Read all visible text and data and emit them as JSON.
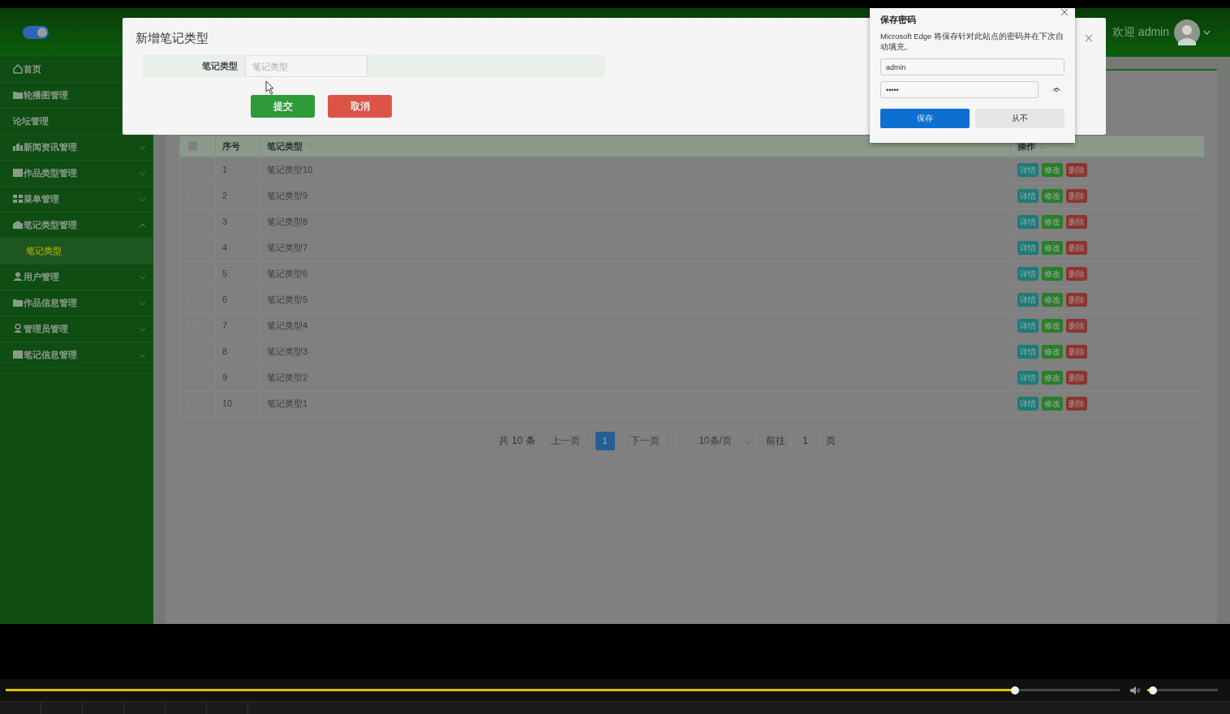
{
  "header": {
    "toggle_on": true,
    "welcome": "欢迎 admin"
  },
  "sidebar": {
    "items": [
      {
        "label": "首页",
        "kind": "link"
      },
      {
        "label": "轮播图管理",
        "kind": "link"
      },
      {
        "label": "论坛管理",
        "kind": "link"
      },
      {
        "label": "新闻资讯管理",
        "kind": "group",
        "expanded": false
      },
      {
        "label": "作品类型管理",
        "kind": "group",
        "expanded": false
      },
      {
        "label": "菜单管理",
        "kind": "group",
        "expanded": false
      },
      {
        "label": "笔记类型管理",
        "kind": "group",
        "expanded": true,
        "children": [
          {
            "label": "笔记类型",
            "selected": true
          }
        ]
      },
      {
        "label": "用户管理",
        "kind": "group",
        "expanded": false
      },
      {
        "label": "作品信息管理",
        "kind": "group",
        "expanded": false
      },
      {
        "label": "管理员管理",
        "kind": "group",
        "expanded": false
      },
      {
        "label": "笔记信息管理",
        "kind": "group",
        "expanded": false
      }
    ]
  },
  "table": {
    "select_all_checked": false,
    "columns": [
      "序号",
      "笔记类型",
      "操作"
    ],
    "rows": [
      {
        "checked": false,
        "cells": [
          "1",
          "笔记类型10"
        ],
        "actions": [
          "详情",
          "修改",
          "删除"
        ]
      },
      {
        "checked": false,
        "cells": [
          "2",
          "笔记类型9"
        ],
        "actions": [
          "详情",
          "修改",
          "删除"
        ]
      },
      {
        "checked": false,
        "cells": [
          "3",
          "笔记类型8"
        ],
        "actions": [
          "详情",
          "修改",
          "删除"
        ]
      },
      {
        "checked": false,
        "cells": [
          "4",
          "笔记类型7"
        ],
        "actions": [
          "详情",
          "修改",
          "删除"
        ]
      },
      {
        "checked": false,
        "cells": [
          "5",
          "笔记类型6"
        ],
        "actions": [
          "详情",
          "修改",
          "删除"
        ]
      },
      {
        "checked": false,
        "cells": [
          "6",
          "笔记类型5"
        ],
        "actions": [
          "详情",
          "修改",
          "删除"
        ]
      },
      {
        "checked": false,
        "cells": [
          "7",
          "笔记类型4"
        ],
        "actions": [
          "详情",
          "修改",
          "删除"
        ]
      },
      {
        "checked": false,
        "cells": [
          "8",
          "笔记类型3"
        ],
        "actions": [
          "详情",
          "修改",
          "删除"
        ]
      },
      {
        "checked": false,
        "cells": [
          "9",
          "笔记类型2"
        ],
        "actions": [
          "详情",
          "修改",
          "删除"
        ]
      },
      {
        "checked": false,
        "cells": [
          "10",
          "笔记类型1"
        ],
        "actions": [
          "详情",
          "修改",
          "删除"
        ]
      }
    ]
  },
  "pagination": {
    "total": "共 10 条",
    "prev": "上一页",
    "pages": [
      {
        "label": "1",
        "selected": true
      }
    ],
    "next": "下一页",
    "page_size": "10条/页",
    "goto": "前往",
    "goto_value": "1",
    "page_unit": "页"
  },
  "modal": {
    "title": "新增笔记类型",
    "field_label": "笔记类型",
    "field_placeholder": "笔记类型",
    "buttons": [
      "提交",
      "取消"
    ]
  },
  "password_popup": {
    "title": "保存密码",
    "message": "Microsoft Edge 将保存针对此站点的密码并在下次自动填充。",
    "username": "admin",
    "password": "•••••",
    "buttons": [
      "保存",
      "从不"
    ]
  },
  "player": {
    "progress": {
      "level": 0.906
    },
    "volume": {
      "level": 0.08
    }
  }
}
